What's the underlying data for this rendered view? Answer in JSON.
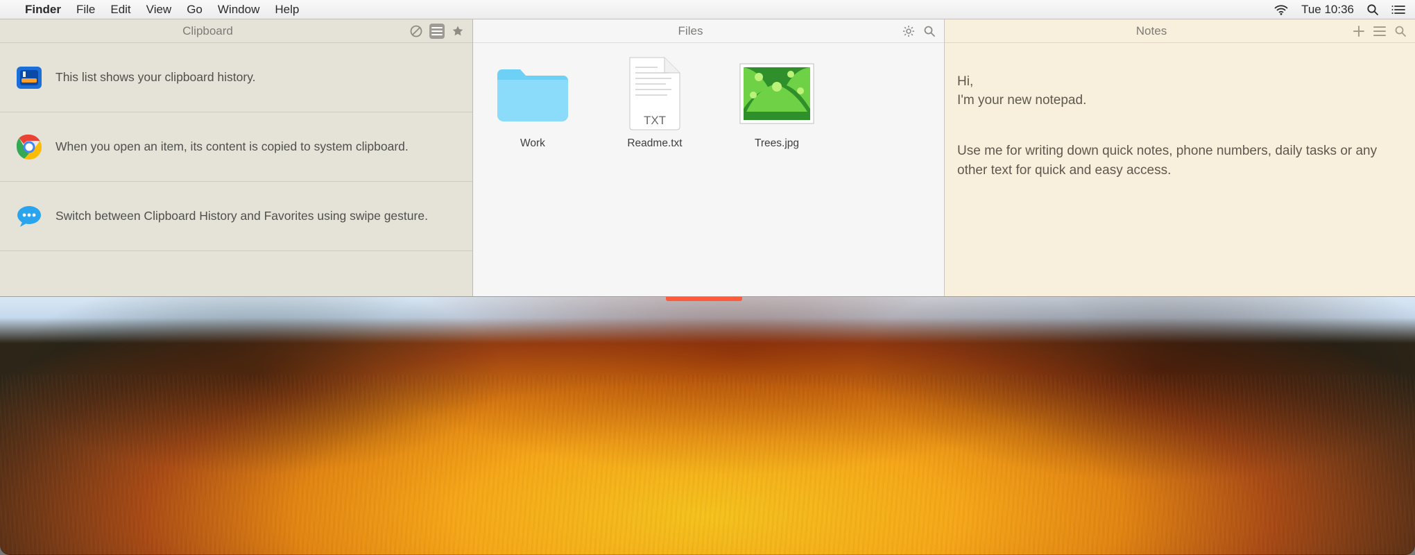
{
  "menubar": {
    "app": "Finder",
    "items": [
      "File",
      "Edit",
      "View",
      "Go",
      "Window",
      "Help"
    ],
    "clock": "Tue 10:36"
  },
  "clipboard": {
    "title": "Clipboard",
    "items": [
      {
        "app": "xcode",
        "text": "This list shows your clipboard history."
      },
      {
        "app": "chrome",
        "text": "When you open an item, its content is copied to system clipboard."
      },
      {
        "app": "messages",
        "text": "Switch between Clipboard History and Favorites using swipe gesture."
      }
    ]
  },
  "files": {
    "title": "Files",
    "items": [
      {
        "kind": "folder",
        "name": "Work"
      },
      {
        "kind": "txt",
        "name": "Readme.txt",
        "badge": "TXT"
      },
      {
        "kind": "image",
        "name": "Trees.jpg"
      }
    ]
  },
  "notes": {
    "title": "Notes",
    "paragraphs": [
      "Hi,\nI'm your new notepad.",
      "Use me for writing down quick notes, phone numbers, daily tasks or any other text for quick and easy access."
    ]
  }
}
